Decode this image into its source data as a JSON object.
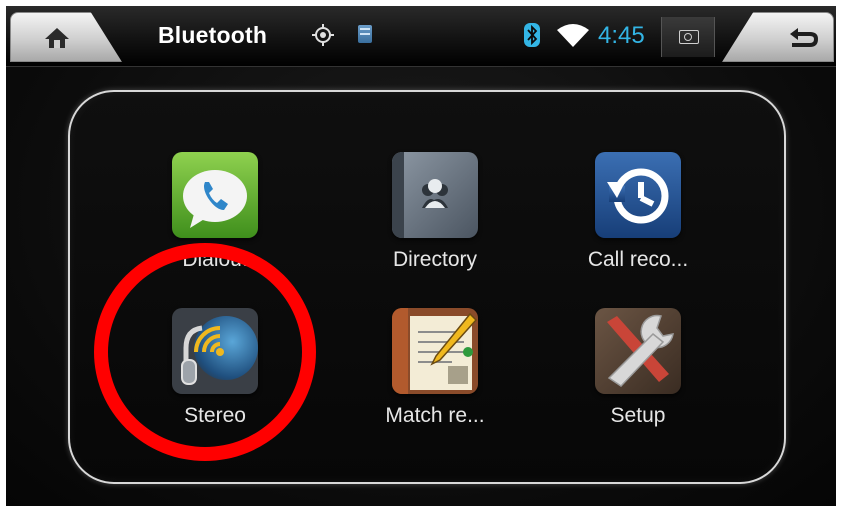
{
  "statusbar": {
    "title": "Bluetooth",
    "time": "4:45",
    "icons": {
      "home": "home-icon",
      "gps": "gps-target-icon",
      "sd": "sd-card-icon",
      "bluetooth": "bluetooth-icon",
      "wifi": "wifi-icon",
      "screenshot": "camera-icon",
      "back": "back-arrow-icon"
    },
    "clock_color": "#33b5e5"
  },
  "apps": [
    {
      "id": "dialout",
      "label": "Dialout",
      "icon": "phone-icon"
    },
    {
      "id": "directory",
      "label": "Directory",
      "icon": "contacts-book-icon"
    },
    {
      "id": "call-records",
      "label": "Call reco...",
      "icon": "history-clock-icon"
    },
    {
      "id": "stereo",
      "label": "Stereo",
      "icon": "headphone-stereo-icon"
    },
    {
      "id": "match-records",
      "label": "Match re...",
      "icon": "notebook-pencil-icon"
    },
    {
      "id": "setup",
      "label": "Setup",
      "icon": "wrench-tools-icon"
    }
  ],
  "annotation": {
    "highlighted": "Stereo",
    "color": "#ff0000"
  }
}
